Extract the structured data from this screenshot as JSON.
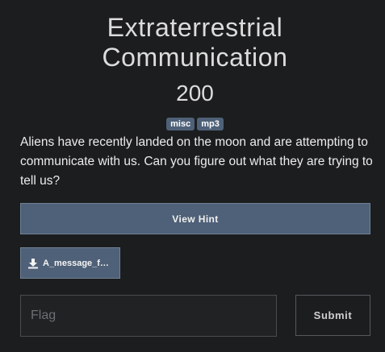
{
  "challenge": {
    "title_line1": "Extraterrestrial",
    "title_line2": "Communication",
    "points": "200",
    "tags": [
      "misc",
      "mp3"
    ],
    "description": "Aliens have recently landed on the moon and are attempting to communicate with us. Can you figure out what they are trying to tell us?"
  },
  "actions": {
    "hint_label": "View Hint",
    "file_label": "A_message_f…",
    "file_icon": "download-icon"
  },
  "form": {
    "flag_placeholder": "Flag",
    "flag_value": "",
    "submit_label": "Submit"
  },
  "colors": {
    "background": "#1c1d1f",
    "accent": "#4f6178"
  }
}
